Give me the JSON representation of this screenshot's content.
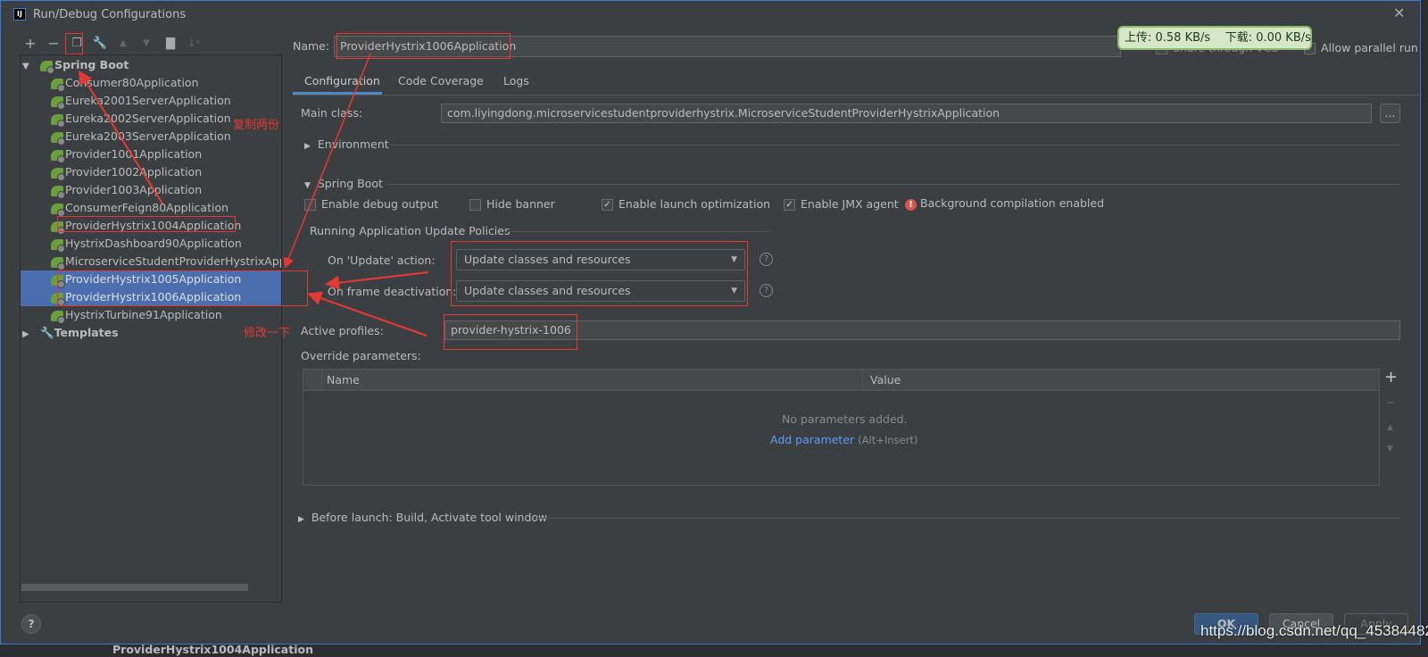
{
  "window": {
    "title": "Run/Debug Configurations",
    "logo": "IJ"
  },
  "toolbar": {
    "icons": [
      "plus-icon",
      "minus-icon",
      "copy-icon",
      "wrench-icon",
      "arrow-up-icon",
      "arrow-down-icon",
      "folder-add-icon",
      "sort-icon"
    ]
  },
  "tree": {
    "root": "Spring Boot",
    "items": [
      "Consumer80Application",
      "Eureka2001ServerApplication",
      "Eureka2002ServerApplication",
      "Eureka2003ServerApplication",
      "Provider1001Application",
      "Provider1002Application",
      "Provider1003Application",
      "ConsumerFeign80Application",
      "ProviderHystrix1004Application",
      "HystrixDashboard90Application",
      "MicroserviceStudentProviderHystrixApplication",
      "ProviderHystrix1005Application",
      "ProviderHystrix1006Application",
      "HystrixTurbine91Application"
    ],
    "selected": [
      "ProviderHystrix1005Application",
      "ProviderHystrix1006Application"
    ],
    "templates": "Templates"
  },
  "name": {
    "label": "Name:",
    "value": "ProviderHystrix1006Application"
  },
  "share": {
    "label": "Share through VCS",
    "parallel": "Allow parallel run"
  },
  "netspeed": {
    "upload": "上传: 0.58 KB/s",
    "download": "下载: 0.00 KB/s"
  },
  "tabs": [
    "Configuration",
    "Code Coverage",
    "Logs"
  ],
  "config": {
    "main_class_label": "Main class:",
    "main_class": "com.liyingdong.microservicestudentproviderhystrix.MicroserviceStudentProviderHystrixApplication",
    "browse": "...",
    "environment": "Environment",
    "spring_boot": "Spring Boot",
    "checks": [
      {
        "label": "Enable debug output",
        "checked": false
      },
      {
        "label": "Hide banner",
        "checked": false
      },
      {
        "label": "Enable launch optimization",
        "checked": true
      },
      {
        "label": "Enable JMX agent",
        "checked": true
      }
    ],
    "bg_compile": "Background compilation enabled",
    "policies": "Running Application Update Policies",
    "on_update_label": "On 'Update' action:",
    "on_update": "Update classes and resources",
    "on_frame_label": "On frame deactivation:",
    "on_frame": "Update classes and resources",
    "profiles_label": "Active profiles:",
    "profiles": "provider-hystrix-1006",
    "override_label": "Override parameters:",
    "col_name": "Name",
    "col_value": "Value",
    "empty": "No parameters added.",
    "add_param": "Add parameter",
    "add_hint": "(Alt+Insert)",
    "before_launch": "Before launch: Build, Activate tool window"
  },
  "buttons": {
    "ok": "OK",
    "cancel": "Cancel",
    "apply": "Apply",
    "help": "?"
  },
  "annotations": {
    "copy": "复制两份",
    "modify": "修改一下"
  },
  "watermark": "https://blog.csdn.net/qq_45384482",
  "background_run": "ProviderHystrix1004Application"
}
